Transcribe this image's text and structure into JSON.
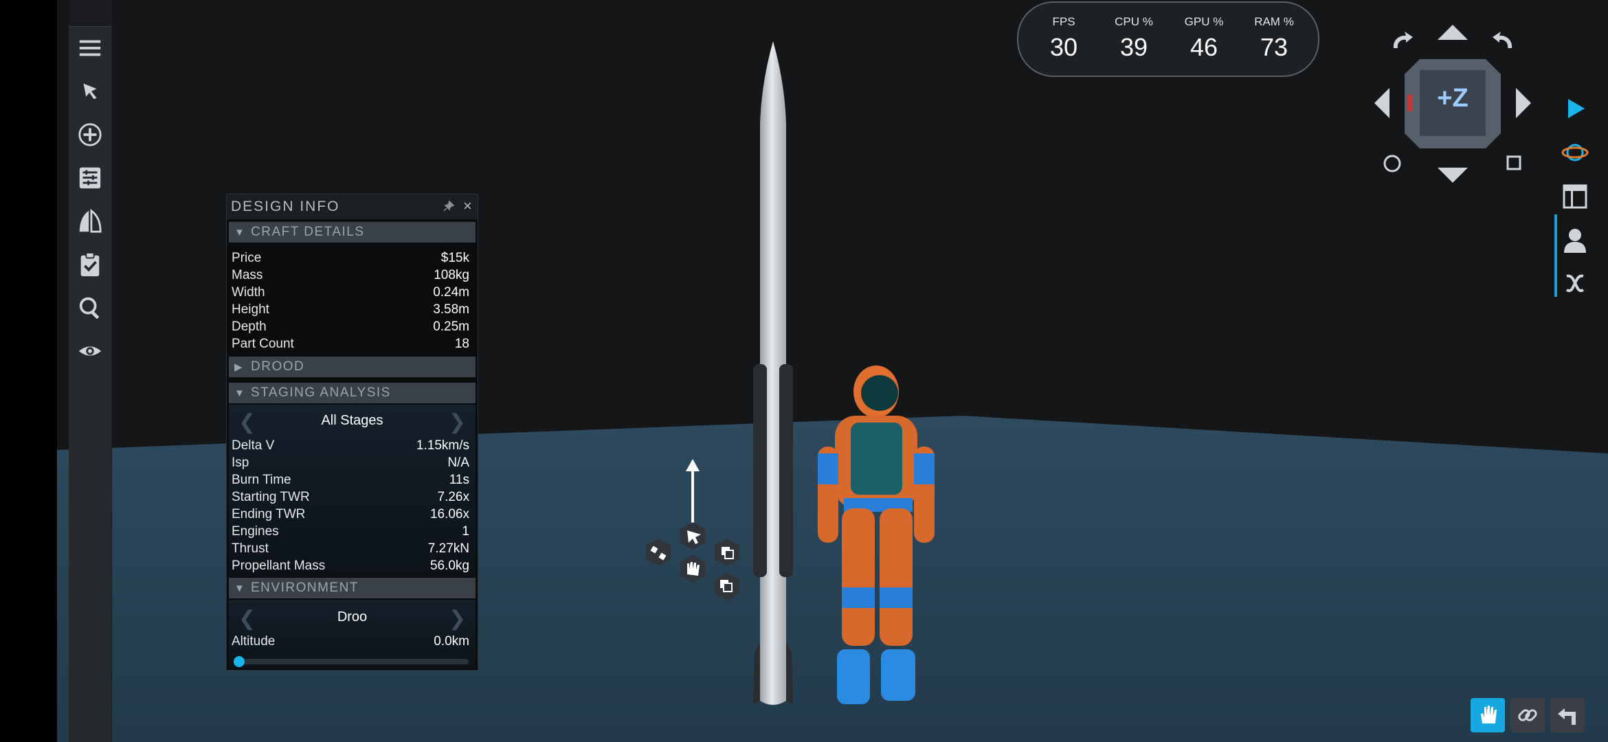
{
  "design_info": {
    "title": "DESIGN INFO",
    "close_glyph": "×",
    "craft_details": {
      "header": "CRAFT DETAILS",
      "rows": [
        {
          "label": "Price",
          "value": "$15k"
        },
        {
          "label": "Mass",
          "value": "108kg"
        },
        {
          "label": "Width",
          "value": "0.24m"
        },
        {
          "label": "Height",
          "value": "3.58m"
        },
        {
          "label": "Depth",
          "value": "0.25m"
        },
        {
          "label": "Part Count",
          "value": "18"
        }
      ]
    },
    "drood": {
      "header": "DROOD"
    },
    "staging_analysis": {
      "header": "STAGING ANALYSIS",
      "selector": "All Stages",
      "rows": [
        {
          "label": "Delta V",
          "value": "1.15km/s"
        },
        {
          "label": "Isp",
          "value": "N/A"
        },
        {
          "label": "Burn Time",
          "value": "11s"
        },
        {
          "label": "Starting TWR",
          "value": "7.26x"
        },
        {
          "label": "Ending TWR",
          "value": "16.06x"
        },
        {
          "label": "Engines",
          "value": "1"
        },
        {
          "label": "Thrust",
          "value": "7.27kN"
        },
        {
          "label": "Propellant Mass",
          "value": "56.0kg"
        }
      ]
    },
    "environment": {
      "header": "ENVIRONMENT",
      "selector": "Droo",
      "rows": [
        {
          "label": "Altitude",
          "value": "0.0km"
        }
      ],
      "altitude_slider_fraction": 0.0
    }
  },
  "performance": [
    {
      "label": "FPS",
      "value": "30"
    },
    {
      "label": "CPU %",
      "value": "39"
    },
    {
      "label": "GPU %",
      "value": "46"
    },
    {
      "label": "RAM %",
      "value": "73"
    }
  ],
  "view_cube": {
    "label": "+Z"
  },
  "toolbar_icons": [
    "menu-icon",
    "select-cursor-icon",
    "add-part-icon",
    "properties-icon",
    "symmetry-icon",
    "checklist-icon",
    "search-icon",
    "eye-icon"
  ],
  "right_icons": [
    "play-icon",
    "orbit-view-icon",
    "layout-view-icon",
    "astronaut-icon",
    "variable-x-icon"
  ],
  "bottom_icons": [
    "hand-icon",
    "link-icon",
    "undo-icon"
  ],
  "colors": {
    "accent": "#18b5e8",
    "ground": "#2b4356",
    "sky": "#141618",
    "panel": "#0b0c0d"
  }
}
